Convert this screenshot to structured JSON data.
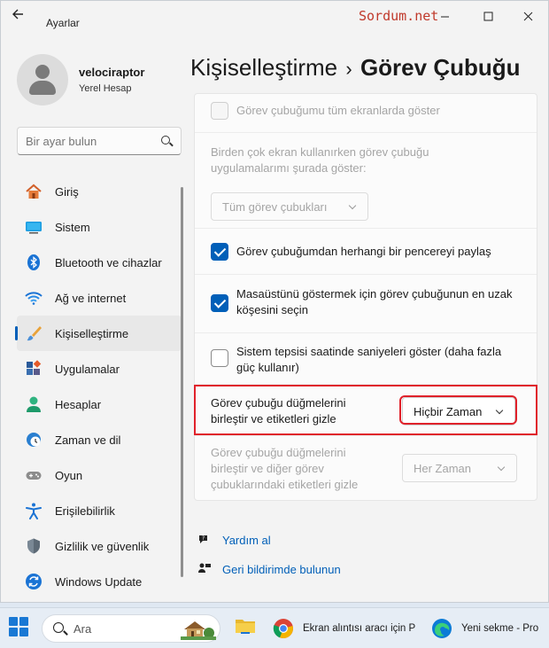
{
  "window": {
    "app_title": "Ayarlar",
    "watermark": "Sordum.net",
    "controls": {
      "minimize": "—",
      "maximize": "☐",
      "close": "✕"
    }
  },
  "profile": {
    "name": "velociraptor",
    "account": "Yerel Hesap"
  },
  "search": {
    "placeholder": "Bir ayar bulun"
  },
  "nav": {
    "items": [
      {
        "label": "Giriş",
        "icon": "home-icon"
      },
      {
        "label": "Sistem",
        "icon": "system-icon"
      },
      {
        "label": "Bluetooth ve cihazlar",
        "icon": "bluetooth-icon"
      },
      {
        "label": "Ağ ve internet",
        "icon": "wifi-icon"
      },
      {
        "label": "Kişiselleştirme",
        "icon": "brush-icon",
        "active": true
      },
      {
        "label": "Uygulamalar",
        "icon": "apps-icon"
      },
      {
        "label": "Hesaplar",
        "icon": "account-icon"
      },
      {
        "label": "Zaman ve dil",
        "icon": "clock-globe-icon"
      },
      {
        "label": "Oyun",
        "icon": "gamepad-icon"
      },
      {
        "label": "Erişilebilirlik",
        "icon": "accessibility-icon"
      },
      {
        "label": "Gizlilik ve güvenlik",
        "icon": "shield-icon"
      },
      {
        "label": "Windows Update",
        "icon": "update-icon"
      }
    ]
  },
  "breadcrumb": {
    "parent": "Kişiselleştirme",
    "separator": "›",
    "current": "Görev Çubuğu"
  },
  "settings": {
    "show_all_displays": {
      "label": "Görev çubuğumu tüm ekranlarda göster",
      "checked": false,
      "disabled": true
    },
    "multi_display_text": "Birden çok ekran kullanırken görev çubuğu uygulamalarımı şurada göster:",
    "multi_display_dropdown": "Tüm görev çubukları",
    "share_window": {
      "label": "Görev çubuğumdan herhangi bir pencereyi paylaş",
      "checked": true
    },
    "desktop_corner": {
      "label": "Masaüstünü göstermek için görev çubuğunun en uzak köşesini seçin",
      "checked": true
    },
    "seconds_clock": {
      "label": "Sistem tepsisi saatinde saniyeleri göster (daha fazla güç kullanır)",
      "checked": false
    },
    "combine_buttons": {
      "label": "Görev çubuğu düğmelerini birleştir ve etiketleri gizle",
      "value": "Hiçbir Zaman"
    },
    "combine_other": {
      "label": "Görev çubuğu düğmelerini birleştir ve diğer görev çubuklarındaki etiketleri gizle",
      "value": "Her Zaman"
    }
  },
  "links": {
    "help": "Yardım al",
    "feedback": "Geri bildirimde bulunun"
  },
  "taskbar": {
    "search_placeholder": "Ara",
    "apps": [
      {
        "label": "Ekran alıntısı aracı için P",
        "icon": "chrome-icon"
      },
      {
        "label": "Yeni sekme - Pro",
        "icon": "edge-icon"
      }
    ]
  },
  "colors": {
    "accent": "#005fb8",
    "highlight": "#e0222b"
  }
}
